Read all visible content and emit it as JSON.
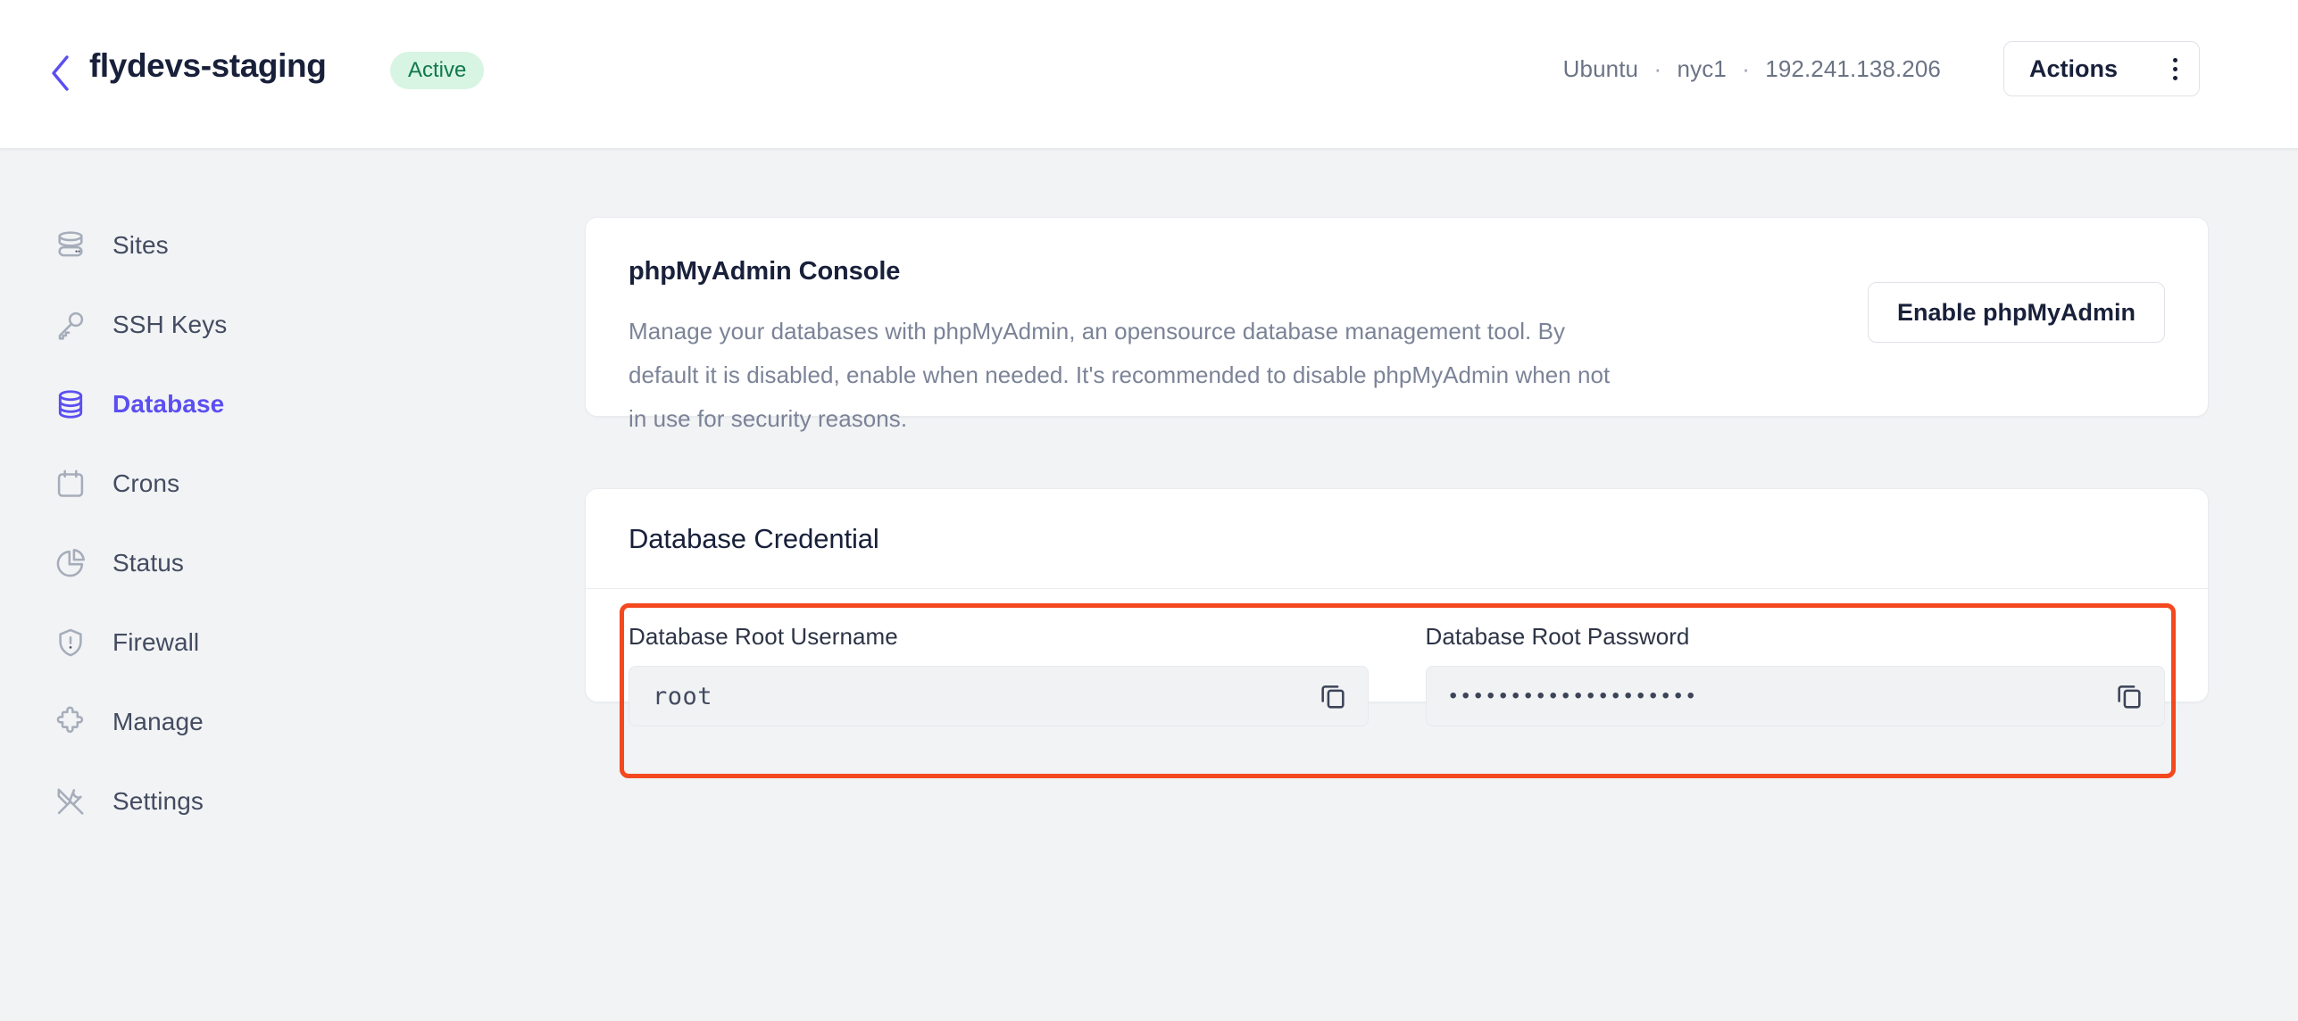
{
  "header": {
    "back_icon": "chevron-left-icon",
    "title": "flydevs-staging",
    "status": "Active",
    "meta": {
      "os": "Ubuntu",
      "region": "nyc1",
      "ip": "192.241.138.206",
      "separator": "·"
    },
    "actions_label": "Actions",
    "actions_icon": "kebab-menu-icon"
  },
  "sidebar": {
    "items": [
      {
        "label": "Sites",
        "icon": "server-icon",
        "active": false
      },
      {
        "label": "SSH Keys",
        "icon": "key-icon",
        "active": false
      },
      {
        "label": "Database",
        "icon": "database-icon",
        "active": true
      },
      {
        "label": "Crons",
        "icon": "calendar-icon",
        "active": false
      },
      {
        "label": "Status",
        "icon": "pie-chart-icon",
        "active": false
      },
      {
        "label": "Firewall",
        "icon": "shield-alert-icon",
        "active": false
      },
      {
        "label": "Manage",
        "icon": "puzzle-icon",
        "active": false
      },
      {
        "label": "Settings",
        "icon": "tools-icon",
        "active": false
      }
    ]
  },
  "phpmyadmin_card": {
    "title": "phpMyAdmin Console",
    "description": "Manage your databases with phpMyAdmin, an opensource database management tool. By default it is disabled, enable when needed. It's recommended to disable phpMyAdmin when not in use for security reasons.",
    "button_label": "Enable phpMyAdmin"
  },
  "credential_card": {
    "title": "Database Credential",
    "username": {
      "label": "Database Root Username",
      "value": "root",
      "copy_icon": "copy-icon"
    },
    "password": {
      "label": "Database Root Password",
      "value": "••••••••••••••••••••",
      "copy_icon": "copy-icon"
    },
    "highlight_color": "#f4481f"
  },
  "colors": {
    "accent": "#5b4ff0",
    "status_bg": "#d7f5e2",
    "status_text": "#10784a",
    "highlight": "#f4481f",
    "page_bg": "#f2f3f5"
  }
}
